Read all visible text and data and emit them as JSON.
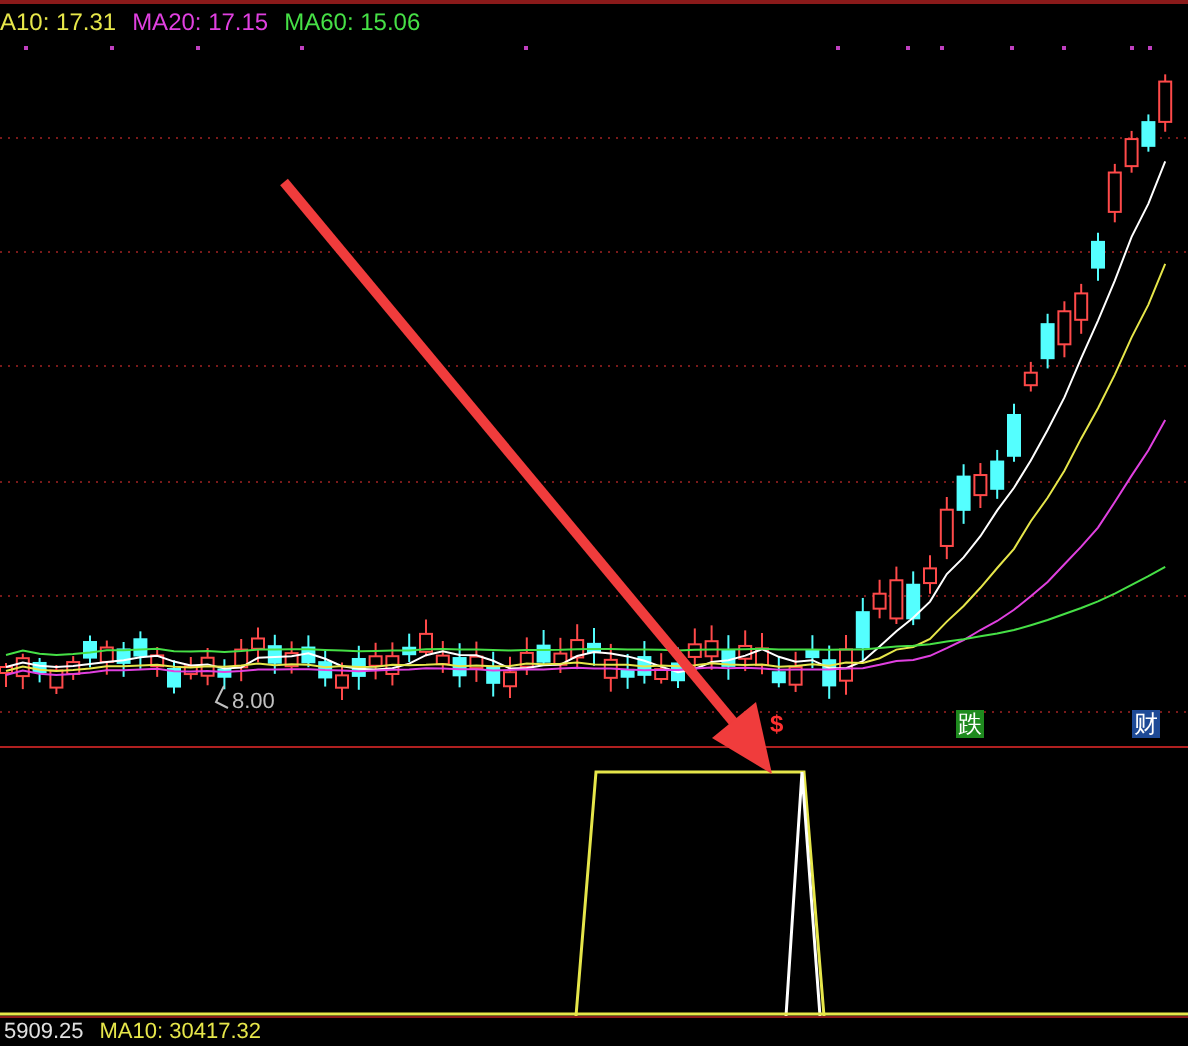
{
  "legend": [
    {
      "label": "A10: 17.31",
      "color": "#e6e64a"
    },
    {
      "label": "MA20: 17.15",
      "color": "#e040e0"
    },
    {
      "label": "MA60: 15.06",
      "color": "#46e046"
    }
  ],
  "price_chart": {
    "low_label": "8.00"
  },
  "signals": [
    {
      "label": "$",
      "kind": "plain",
      "color": "#ff3030"
    },
    {
      "label": "跌",
      "kind": "boxed",
      "color": "#1e8a1e"
    },
    {
      "label": "财",
      "kind": "boxed",
      "color": "#1e4a96"
    }
  ],
  "volume_legend": [
    {
      "label": "5909.25",
      "color": "#e0e0e0"
    },
    {
      "label": "MA10: 30417.32",
      "color": "#e6e64a"
    }
  ]
}
